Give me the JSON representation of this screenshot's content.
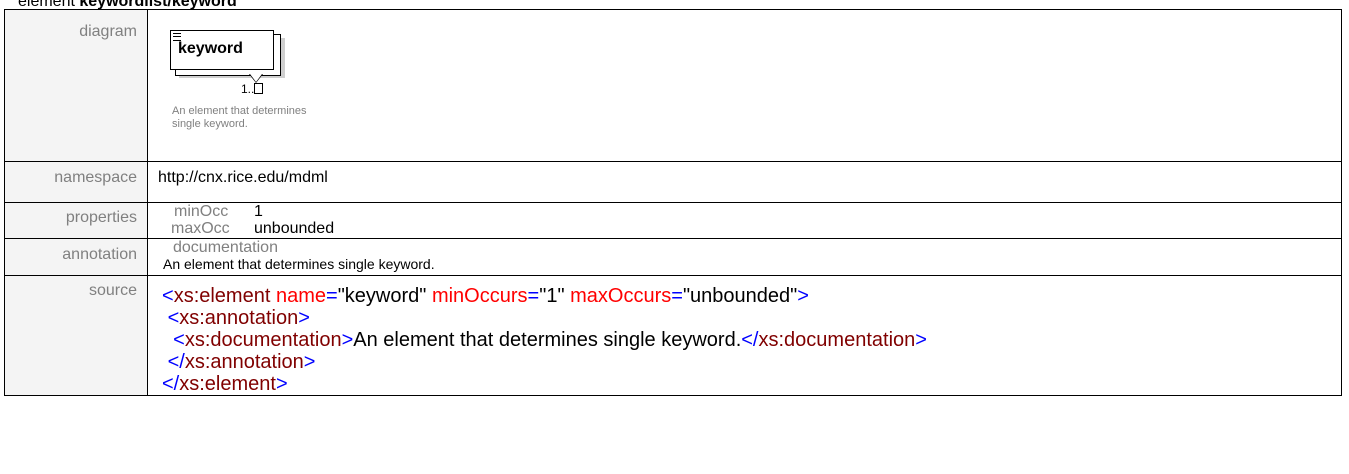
{
  "heading": {
    "prefix": "element",
    "name": "keywordlist/keyword"
  },
  "labels": {
    "diagram": "diagram",
    "namespace": "namespace",
    "properties": "properties",
    "annotation": "annotation",
    "source": "source"
  },
  "diagram": {
    "element_name": "keyword",
    "occurrence": "1..",
    "description_line1": "An element that determines",
    "description_line2": "single keyword."
  },
  "namespace": "http://cnx.rice.edu/mdml",
  "properties": {
    "minOcc_label": "minOcc",
    "minOcc_value": "1",
    "maxOcc_label": "maxOcc",
    "maxOcc_value": "unbounded"
  },
  "annotation": {
    "label": "documentation",
    "text": "An element that determines single keyword."
  },
  "source": {
    "open_lt": "<",
    "close_lt": "</",
    "gt": ">",
    "eq": "=",
    "q": "\"",
    "element_tag": "xs:element",
    "name_attr": "name",
    "name_val": "keyword",
    "minOccurs_attr": "minOccurs",
    "minOccurs_val": "1",
    "maxOccurs_attr": "maxOccurs",
    "maxOccurs_val": "unbounded",
    "annotation_tag": "xs:annotation",
    "documentation_tag": "xs:documentation",
    "documentation_text": "An element that determines single keyword."
  },
  "colors": {
    "tag": "#0000ff",
    "bracket": "#0000ff",
    "attr": "#ff0000",
    "text": "#000000",
    "label_gray": "#808080"
  }
}
